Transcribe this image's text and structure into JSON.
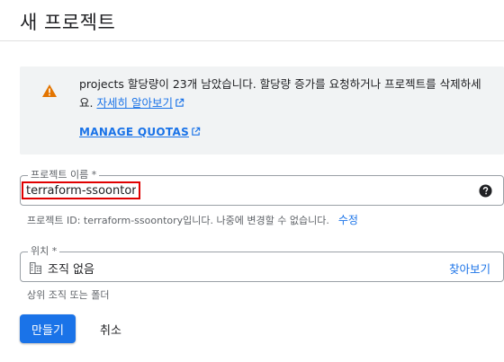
{
  "header": {
    "title": "새 프로젝트"
  },
  "quota_notice": {
    "message": "projects 할당량이 23개 남았습니다. 할당량 증가를 요청하거나 프로젝트를 삭제하세요.",
    "learn_more_link": "자세히 알아보기",
    "manage_quotas_link": "MANAGE QUOTAS",
    "icon": "warning-icon",
    "icon_color": "#e37400"
  },
  "project_name": {
    "label": "프로젝트 이름 *",
    "value": "terraform-ssoontory",
    "help_icon": "help-icon"
  },
  "project_id": {
    "text": "프로젝트 ID: terraform-ssoontory입니다. 나중에 변경할 수 없습니다.",
    "edit_link": "수정"
  },
  "location": {
    "label": "위치 *",
    "value": "조직 없음",
    "icon": "building-icon",
    "browse_link": "찾아보기",
    "hint": "상위 조직 또는 폴더"
  },
  "actions": {
    "create_label": "만들기",
    "cancel_label": "취소"
  },
  "colors": {
    "primary": "#1a73e8",
    "highlight_border": "#e00000",
    "notice_bg": "#f1f3f4"
  }
}
